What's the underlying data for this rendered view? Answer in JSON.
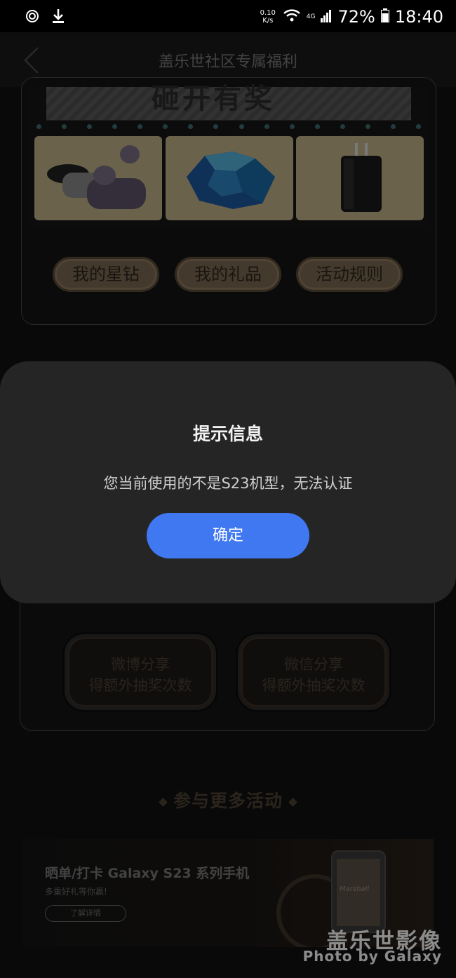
{
  "status_bar": {
    "speed_value": "0.10",
    "speed_unit": "K/s",
    "network": "4G",
    "battery": "72%",
    "time": "18:40"
  },
  "header": {
    "title": "盖乐世社区专属福利"
  },
  "lottery": {
    "banner_text": "砸开有奖",
    "prizes": [
      {
        "icon": "earbuds-icon"
      },
      {
        "icon": "gem-icon"
      },
      {
        "icon": "charger-icon"
      }
    ],
    "buttons": [
      "我的星钻",
      "我的礼品",
      "活动规则"
    ]
  },
  "share": {
    "weibo": [
      "微博分享",
      "得额外抽奖次数"
    ],
    "wechat": [
      "微信分享",
      "得额外抽奖次数"
    ]
  },
  "more_activities": {
    "heading": "参与更多活动"
  },
  "promo": {
    "title": "晒单/打卡 Galaxy S23 系列手机",
    "subtitle": "多重好礼等你赢!",
    "button": "了解详情",
    "device_text": "Marshall"
  },
  "watermark": {
    "line1": "盖乐世影像",
    "line2": "Photo by Galaxy"
  },
  "dialog": {
    "title": "提示信息",
    "message": "您当前使用的不是S23机型，无法认证",
    "confirm": "确定",
    "confirm_color": "#3f78f0"
  }
}
